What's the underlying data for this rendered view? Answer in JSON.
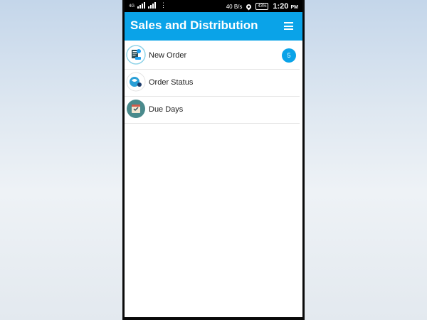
{
  "status_bar": {
    "network_label": "4G",
    "speed": "40 B/s",
    "battery": "43%",
    "time": "1:20",
    "ampm": "PM",
    "icons": [
      "signal-icon",
      "wifi-icon",
      "more-icon",
      "location-icon",
      "battery-icon"
    ]
  },
  "app_bar": {
    "title": "Sales and Distribution",
    "menu_icon": "hamburger-menu-icon",
    "color": "#0aa3e8"
  },
  "menu": {
    "items": [
      {
        "label": "New Order",
        "icon": "new-order-icon",
        "badge": "5"
      },
      {
        "label": "Order Status",
        "icon": "order-status-icon"
      },
      {
        "label": "Due Days",
        "icon": "due-days-icon"
      }
    ]
  }
}
